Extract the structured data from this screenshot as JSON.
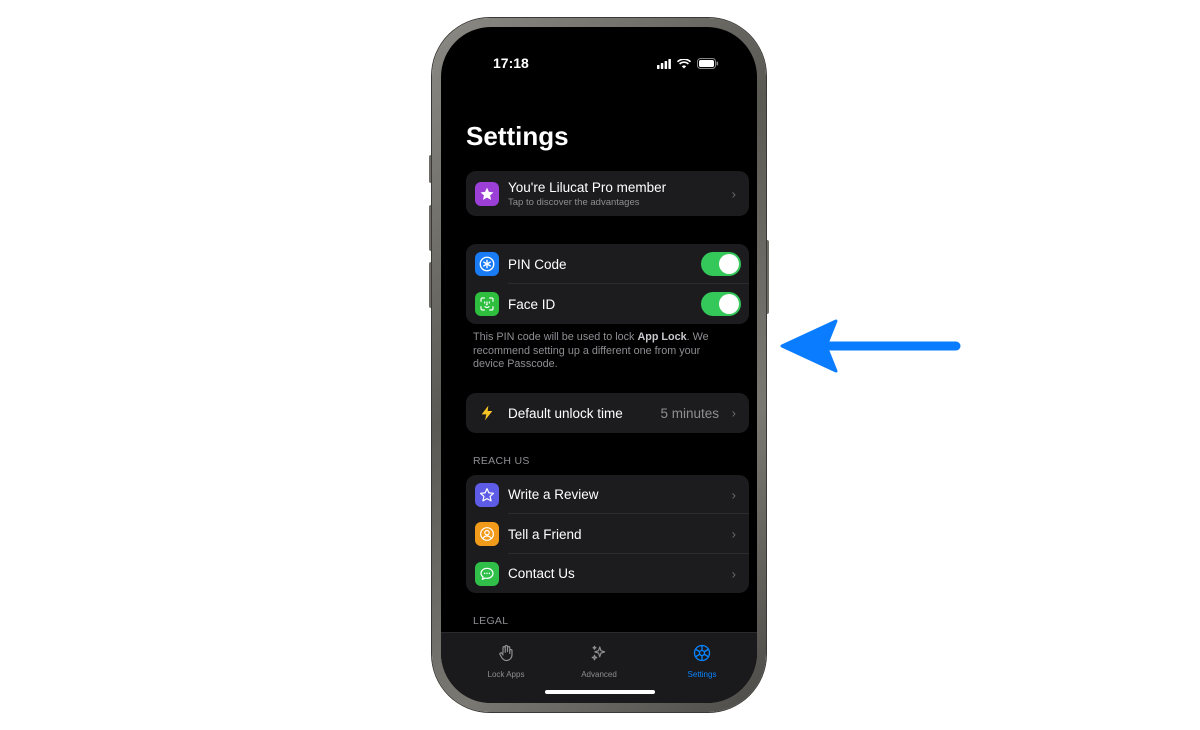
{
  "status": {
    "time": "17:18"
  },
  "page": {
    "title": "Settings"
  },
  "pro": {
    "title": "You're Lilucat Pro member",
    "subtitle": "Tap to discover the advantages",
    "icon": "star-icon",
    "color": "#9b3fd6"
  },
  "security": {
    "items": [
      {
        "label": "PIN Code",
        "icon": "asterisk-icon",
        "color": "#1a7cf5",
        "enabled": true
      },
      {
        "label": "Face ID",
        "icon": "face-id-icon",
        "color": "#2fbf3e",
        "enabled": true
      }
    ],
    "note_prefix": "This PIN code will be used to lock ",
    "note_bold": "App Lock",
    "note_suffix": ". We recommend setting up a different one from your device Passcode."
  },
  "unlock": {
    "label": "Default unlock time",
    "value": "5 minutes",
    "icon": "bolt-icon",
    "color": "#f7c325"
  },
  "reach_us": {
    "header": "REACH US",
    "items": [
      {
        "label": "Write a Review",
        "icon": "star-outline-icon",
        "color": "#5e5ce6"
      },
      {
        "label": "Tell a Friend",
        "icon": "person-icon",
        "color": "#f29a1a"
      },
      {
        "label": "Contact Us",
        "icon": "message-icon",
        "color": "#30c04a"
      }
    ]
  },
  "legal": {
    "header": "LEGAL"
  },
  "tabbar": {
    "tabs": [
      {
        "label": "Lock Apps",
        "icon": "hand-icon",
        "active": false
      },
      {
        "label": "Advanced",
        "icon": "sparkles-icon",
        "active": false
      },
      {
        "label": "Settings",
        "icon": "gear-icon",
        "active": true
      }
    ],
    "active_color": "#0a84ff"
  },
  "annotation": {
    "icon": "arrow-left-icon",
    "color": "#0a7cff"
  }
}
